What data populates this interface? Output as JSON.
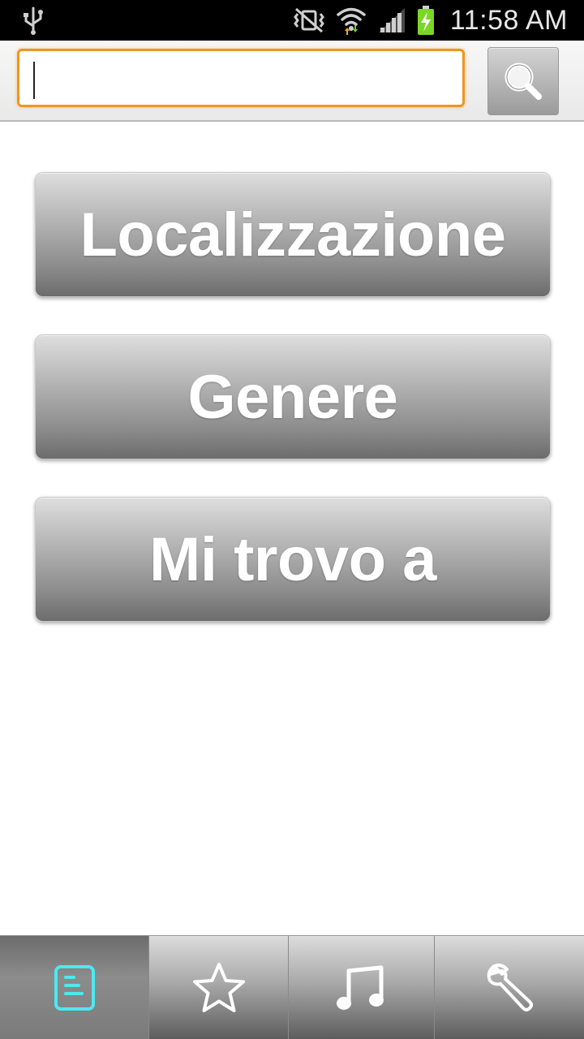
{
  "status_bar": {
    "time": "11:58 AM",
    "icons": [
      "usb-icon",
      "mute-vibrate-icon",
      "wifi-icon",
      "signal-icon",
      "battery-charging-icon"
    ]
  },
  "search": {
    "value": "",
    "placeholder": "",
    "button_icon": "search-icon",
    "accent_color": "#f0951f"
  },
  "menu": {
    "buttons": [
      {
        "label": "Localizzazione"
      },
      {
        "label": "Genere"
      },
      {
        "label": "Mi trovo a"
      }
    ]
  },
  "tabs": [
    {
      "icon": "list-icon",
      "active": true,
      "icon_color": "#4de8f0"
    },
    {
      "icon": "star-icon",
      "active": false
    },
    {
      "icon": "music-note-icon",
      "active": false
    },
    {
      "icon": "wrench-icon",
      "active": false
    }
  ]
}
